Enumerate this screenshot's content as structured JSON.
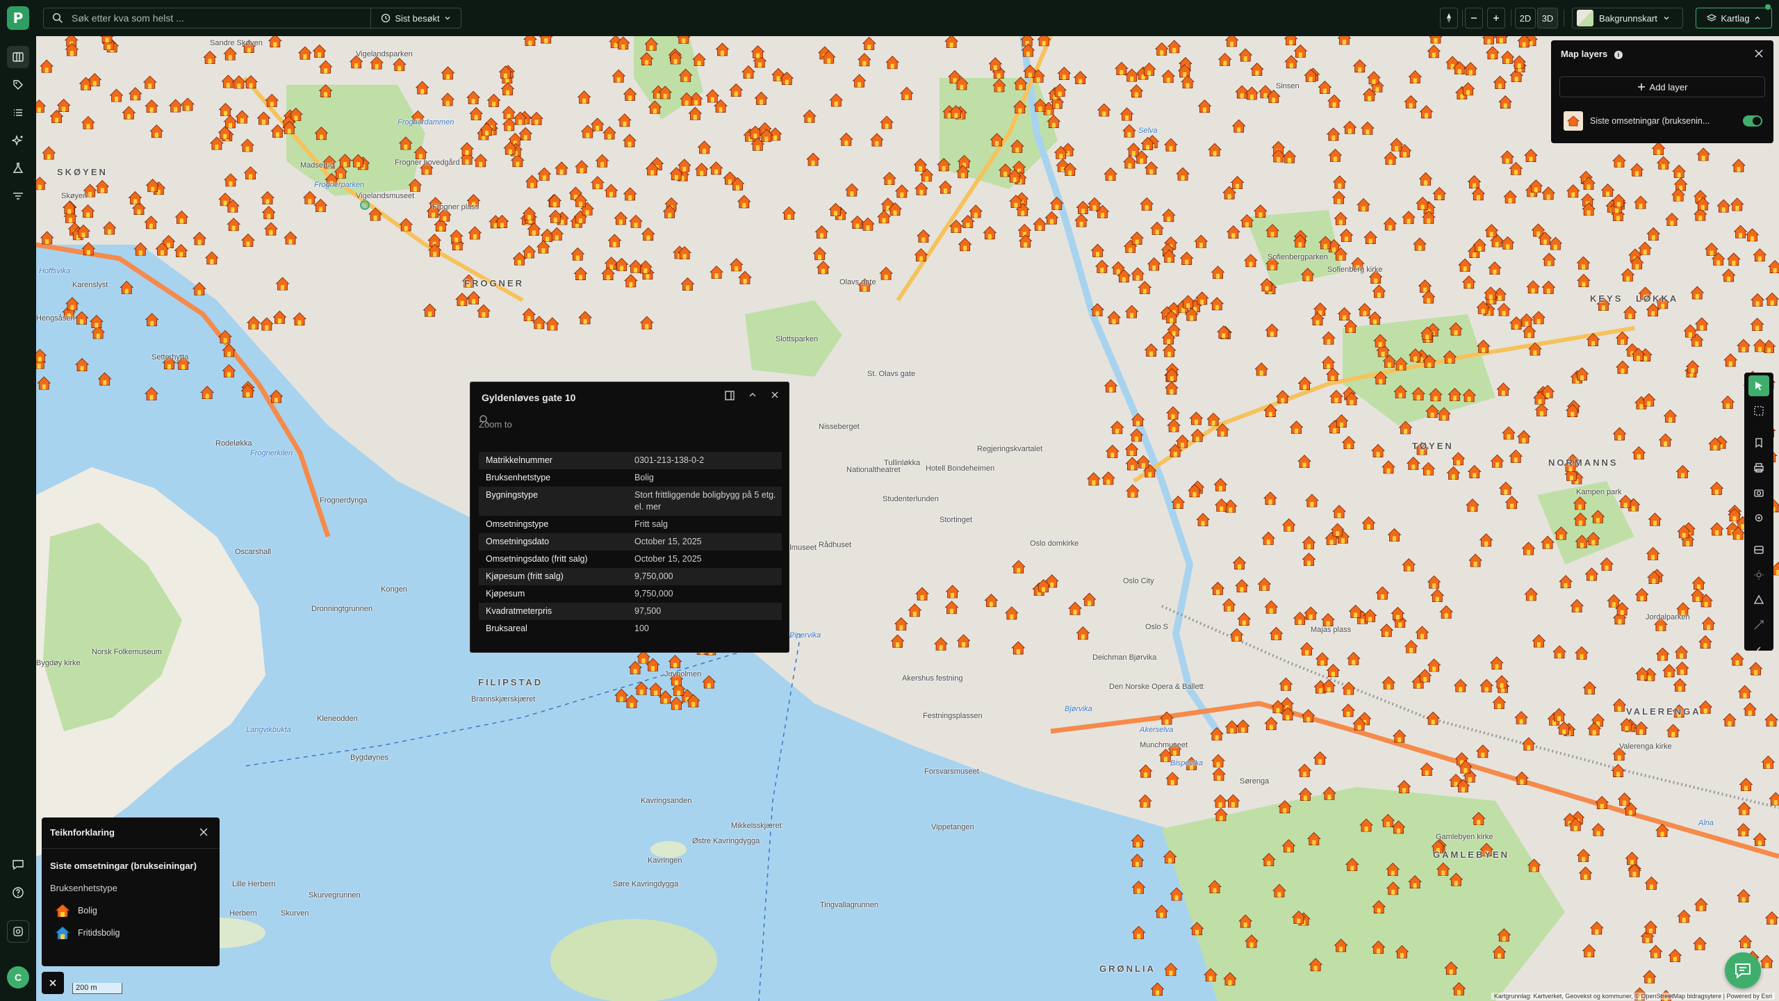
{
  "app": {
    "logo_letter": "P"
  },
  "search": {
    "placeholder": "Søk etter kva som helst ...",
    "recent_label": "Sist besøkt"
  },
  "toolbar": {
    "view_2d": "2D",
    "view_3d": "3D",
    "basemap_label": "Bakgrunnskart",
    "layers_label": "Kartlag"
  },
  "left_rail": {
    "items": [
      "map-icon",
      "tag-icon",
      "list-icon",
      "sparkle-icon",
      "flask-icon",
      "filter-icon"
    ],
    "bottom": [
      "message-icon",
      "help-icon",
      "settings-icon"
    ],
    "avatar_letter": "C"
  },
  "popup": {
    "title": "Gyldenløves gate 10",
    "zoom_label": "Zoom to",
    "rows": [
      {
        "k": "Matrikkelnummer",
        "v": "0301-213-138-0-2"
      },
      {
        "k": "Bruksenhetstype",
        "v": "Bolig"
      },
      {
        "k": "Bygningstype",
        "v": "Stort frittliggende boligbygg på 5 etg. el. mer"
      },
      {
        "k": "Omsetningstype",
        "v": "Fritt salg"
      },
      {
        "k": "Omsetningsdato",
        "v": "October 15, 2025"
      },
      {
        "k": "Omsetningsdato (fritt salg)",
        "v": "October 15, 2025"
      },
      {
        "k": "Kjøpesum (fritt salg)",
        "v": "9,750,000"
      },
      {
        "k": "Kjøpesum",
        "v": "9,750,000"
      },
      {
        "k": "Kvadratmeterpris",
        "v": "97,500"
      },
      {
        "k": "Bruksareal",
        "v": "100"
      }
    ]
  },
  "layers_panel": {
    "title": "Map layers",
    "add_label": "Add layer",
    "layer_name": "Siste omsetningar (bruksenin...",
    "layer_visible": true
  },
  "legend": {
    "title": "Teiknforklaring",
    "layer": "Siste omsetningar (brukseiningar)",
    "field": "Bruksenhetstype",
    "items": [
      {
        "label": "Bolig",
        "color": "#f06a1a"
      },
      {
        "label": "Fritidsbolig",
        "color": "#2d8fd6"
      }
    ]
  },
  "scale": "200 m",
  "attribution": "Kartgrunnlag: Kartverket, Geovekst og kommuner, © OpenStreetMap bidragsytere | Powered by Esri",
  "map_labels": {
    "districts": [
      "SKØYEN",
      "FROGNER",
      "FILIPSTAD",
      "TØYEN",
      "NORMANNS",
      "VALERENGA",
      "GAMLEBYEN",
      "GRØNLIA",
      "KEYS",
      "LØKKA"
    ],
    "places": [
      "Sandre Skøyen",
      "Vigelandsparken",
      "Frognerdammen",
      "Frognerparken",
      "Frogner hovedgård",
      "Vigelandsmuseet",
      "Madserud",
      "Frogner plass",
      "Skøyen",
      "Hoffsvika",
      "Karenslyst",
      "Hengsåsen",
      "Setterhytta",
      "Rodeløkka",
      "Frognerkilen",
      "Frognerdynga",
      "Oscarshall",
      "Kongen",
      "Dronningtgrunnen",
      "Norsk Folkemuseum",
      "Bygdøy kirke",
      "Kleneodden",
      "Langvikbukta",
      "Bygdøynes",
      "Lille Herbern",
      "Herbern",
      "Skurven",
      "Skurvegrunnen",
      "Brannskjærskjæret",
      "Juvholmen",
      "Pipervika",
      "Akershus festning",
      "Festningsplassen",
      "Forsvarsmuseet",
      "Kavringsanden",
      "Østre Kavringdygga",
      "Kavringen",
      "Søre Kavringdygga",
      "Tingvallagrunnen",
      "Bjørvika",
      "Akerselva",
      "Munchmuseet",
      "Bispevika",
      "Sørenga",
      "Gamlebyen kirke",
      "Oslo S",
      "Oslo City",
      "Oslo domkirke",
      "Stortinget",
      "Rådhuset",
      "Nasjonalmuseet",
      "Nationaltheatret",
      "Slottsparken",
      "Nisseberget",
      "Regjeringskvartalet",
      "St. Olavs gate",
      "Sofienbergparken",
      "Sofienberg kirke",
      "Kampen park",
      "Valerenga kirke",
      "Alna",
      "Selva",
      "Sinsen",
      "Jordalparken",
      "Majas plass",
      "Deichman Bjørvika",
      "Den Norske Opera & Ballett",
      "Mikkelsskjæret",
      "Vippetangen",
      "Olavs gate",
      "Tullinløkka",
      "Studenterlunden",
      "Hotell Bondeheimen"
    ]
  }
}
